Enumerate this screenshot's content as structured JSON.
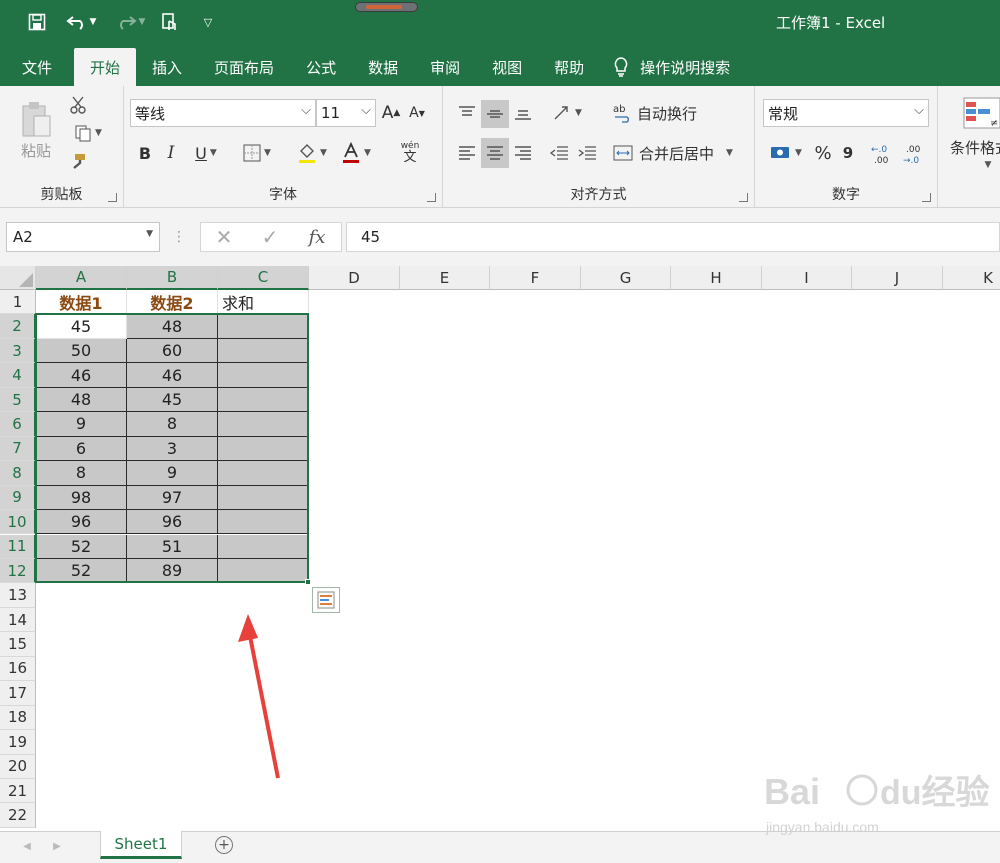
{
  "window": {
    "title": "工作簿1  -  Excel"
  },
  "quick_access": {
    "icons": [
      "save-icon",
      "undo-icon",
      "redo-icon",
      "touch-mode-icon",
      "customize-icon"
    ]
  },
  "tabs": [
    "文件",
    "开始",
    "插入",
    "页面布局",
    "公式",
    "数据",
    "审阅",
    "视图",
    "帮助"
  ],
  "active_tab": "开始",
  "tell_me": "操作说明搜索",
  "ribbon": {
    "clipboard": {
      "label": "剪贴板",
      "paste": "粘贴"
    },
    "font": {
      "label": "字体",
      "font_name": "等线",
      "font_size": "11",
      "bold": "B",
      "italic": "I",
      "underline": "U",
      "grow": "A",
      "shrink": "A",
      "phonetic": "wén",
      "phonetic_char": "文"
    },
    "alignment": {
      "label": "对齐方式",
      "wrap_text": "自动换行",
      "merge_center": "合并后居中"
    },
    "number": {
      "label": "数字",
      "format": "常规",
      "percent": "%",
      "comma": "9",
      "inc_decimal": "←.0 .00",
      "dec_decimal": ".00 →.0"
    },
    "styles": {
      "conditional": "条件格式"
    }
  },
  "formula_bar": {
    "name_box": "A2",
    "formula": "45",
    "fx": "fx"
  },
  "columns": [
    "A",
    "B",
    "C",
    "D",
    "E",
    "F",
    "G",
    "H",
    "I",
    "J",
    "K"
  ],
  "rows": [
    "1",
    "2",
    "3",
    "4",
    "5",
    "6",
    "7",
    "8",
    "9",
    "10",
    "11",
    "12",
    "13",
    "14",
    "15",
    "16",
    "17",
    "18",
    "19",
    "20",
    "21",
    "22"
  ],
  "cells": {
    "header": [
      "数据1",
      "数据2",
      "求和"
    ],
    "data": [
      [
        "45",
        "48"
      ],
      [
        "50",
        "60"
      ],
      [
        "46",
        "46"
      ],
      [
        "48",
        "45"
      ],
      [
        "9",
        "8"
      ],
      [
        "6",
        "3"
      ],
      [
        "8",
        "9"
      ],
      [
        "98",
        "97"
      ],
      [
        "96",
        "96"
      ],
      [
        "52",
        "51"
      ],
      [
        "52",
        "89"
      ]
    ]
  },
  "sheets": [
    "Sheet1"
  ],
  "watermark": "Baidu经验 jingyan.baidu.com",
  "colors": {
    "accent": "#217346",
    "selection_fill": "#c8c8c8",
    "header_text": "#8b4a12",
    "arrow": "#e8403a"
  }
}
